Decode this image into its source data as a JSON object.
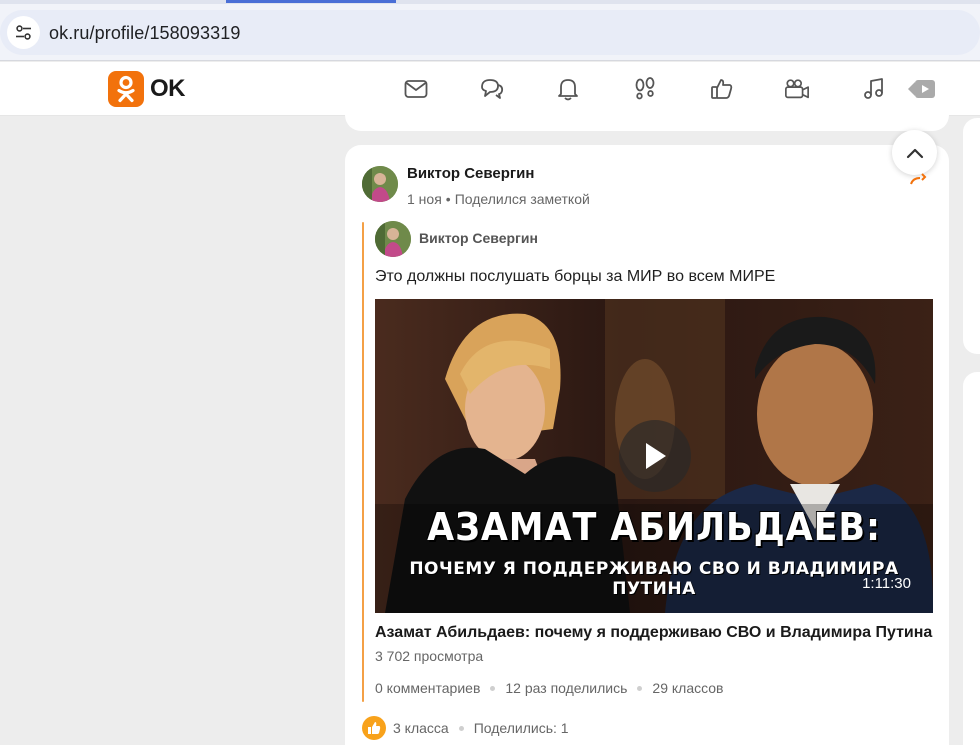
{
  "browser": {
    "url": "ok.ru/profile/158093319"
  },
  "header": {
    "logo_text": "OK",
    "brand_color": "#f2720c",
    "nav_icons": [
      "mail-icon",
      "chat-icon",
      "bell-icon",
      "footprints-icon",
      "thumbs-up-icon",
      "video-camera-icon",
      "music-icon",
      "video-play-icon"
    ]
  },
  "post": {
    "author": "Виктор Севергин",
    "date": "1 ноя",
    "action": "Поделился заметкой",
    "inner": {
      "author": "Виктор Севергин",
      "text": "Это должны послушать борцы за МИР во всем МИРЕ",
      "video": {
        "overlay_title_line1": "АЗАМАТ АБИЛЬДАЕВ:",
        "overlay_title_line2": "ПОЧЕМУ Я ПОДДЕРЖИВАЮ СВО И ВЛАДИМИРА ПУТИНА",
        "duration": "1:11:30",
        "title": "Азамат Абильдаев: почему я поддерживаю СВО и Владимира Путина",
        "views": "3 702 просмотра"
      },
      "stats": {
        "comments": "0 комментариев",
        "shares": "12 раз поделились",
        "classes": "29 классов"
      }
    },
    "footer": {
      "likes": "3 класса",
      "shares": "Поделились: 1"
    }
  }
}
